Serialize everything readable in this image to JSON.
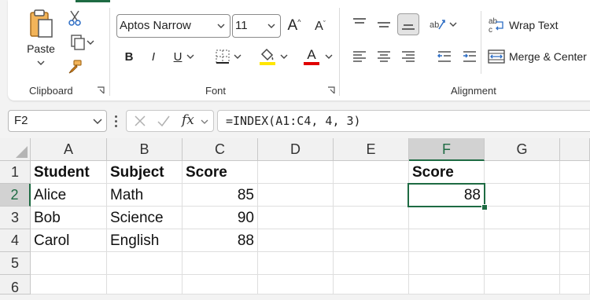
{
  "ribbon": {
    "clipboard": {
      "paste_label": "Paste",
      "group_label": "Clipboard"
    },
    "font": {
      "font_name": "Aptos Narrow",
      "font_size": "11",
      "bold": "B",
      "italic": "I",
      "underline": "U",
      "grow_label": "A",
      "shrink_label": "A",
      "font_color_label": "A",
      "group_label": "Font"
    },
    "alignment": {
      "wrap_text_label": "Wrap Text",
      "merge_label": "Merge & Center",
      "group_label": "Alignment"
    }
  },
  "formula_bar": {
    "name_box": "F2",
    "fx_label": "fx",
    "formula": "=INDEX(A1:C4, 4, 3)"
  },
  "sheet": {
    "columns": [
      "A",
      "B",
      "C",
      "D",
      "E",
      "F",
      "G"
    ],
    "rows": [
      "1",
      "2",
      "3",
      "4",
      "5",
      "6"
    ],
    "cells": {
      "A1": "Student",
      "B1": "Subject",
      "C1": "Score",
      "F1": "Score",
      "A2": "Alice",
      "B2": "Math",
      "C2": "85",
      "F2": "88",
      "A3": "Bob",
      "B3": "Science",
      "C3": "90",
      "A4": "Carol",
      "B4": "English",
      "C4": "88"
    },
    "active_cell": "F2"
  },
  "colors": {
    "accent": "#1e6b43",
    "highlight": "#ffe600",
    "font_color": "#e00000"
  }
}
